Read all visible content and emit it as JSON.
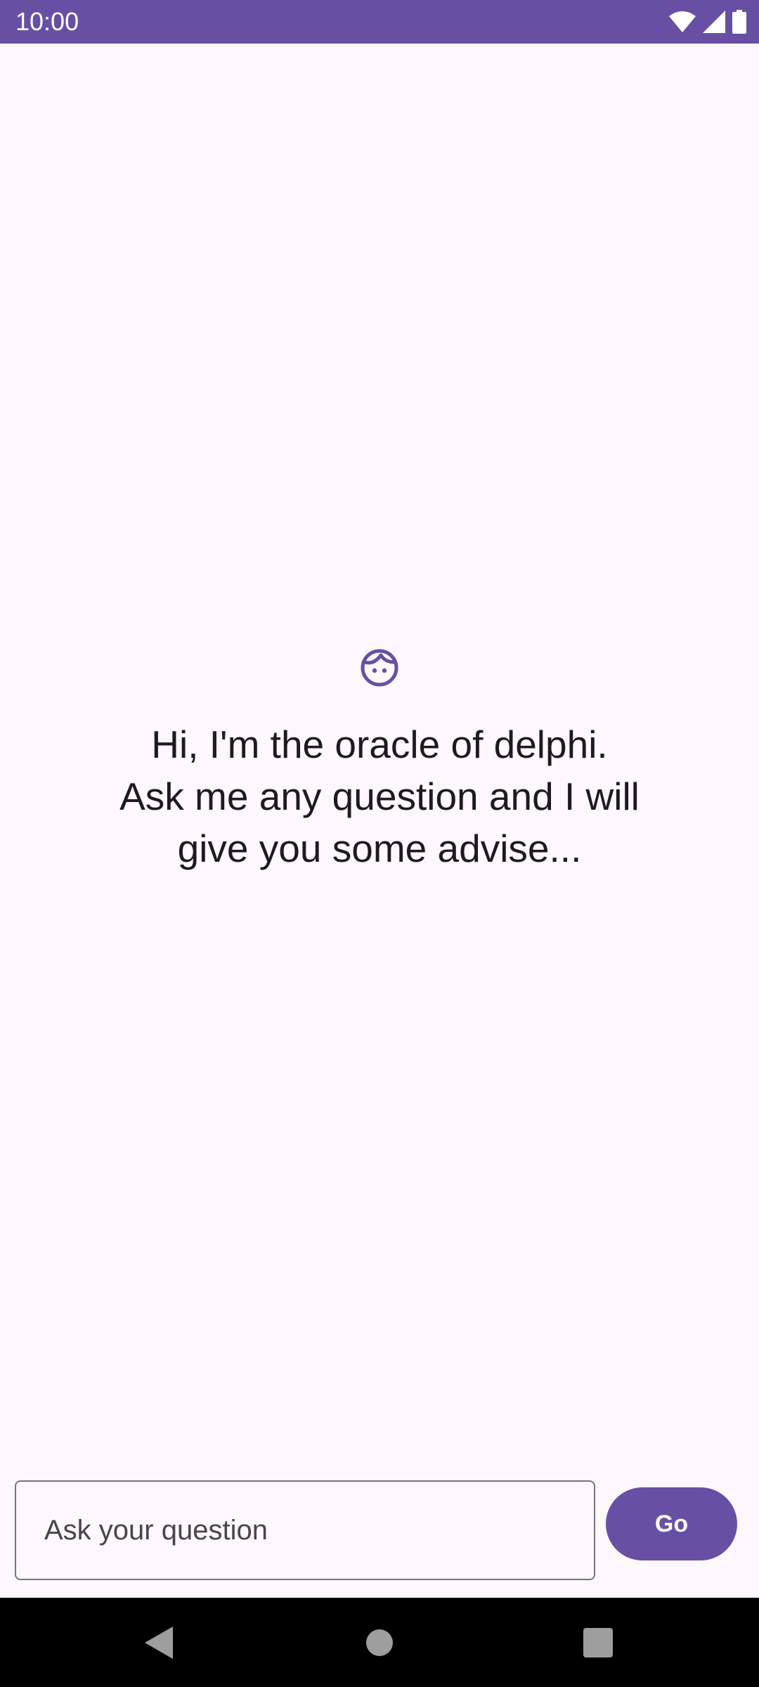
{
  "status_bar": {
    "time": "10:00",
    "icons": [
      "wifi-icon",
      "cellular-signal-icon",
      "battery-icon"
    ],
    "background_color": "#6750A4"
  },
  "main": {
    "icon": "face-icon",
    "greeting": "Hi, I'm the oracle of delphi.\nAsk me any question and I will\ngive you some advise..."
  },
  "input": {
    "placeholder": "Ask your question",
    "value": ""
  },
  "go_button": {
    "label": "Go",
    "color": "#6750A4"
  },
  "nav_bar": {
    "icons": [
      "back-icon",
      "home-icon",
      "recents-icon"
    ]
  },
  "colors": {
    "accent": "#6750A4",
    "background": "#FEF7FC",
    "text": "#1D1B20",
    "outline": "#79747E"
  }
}
